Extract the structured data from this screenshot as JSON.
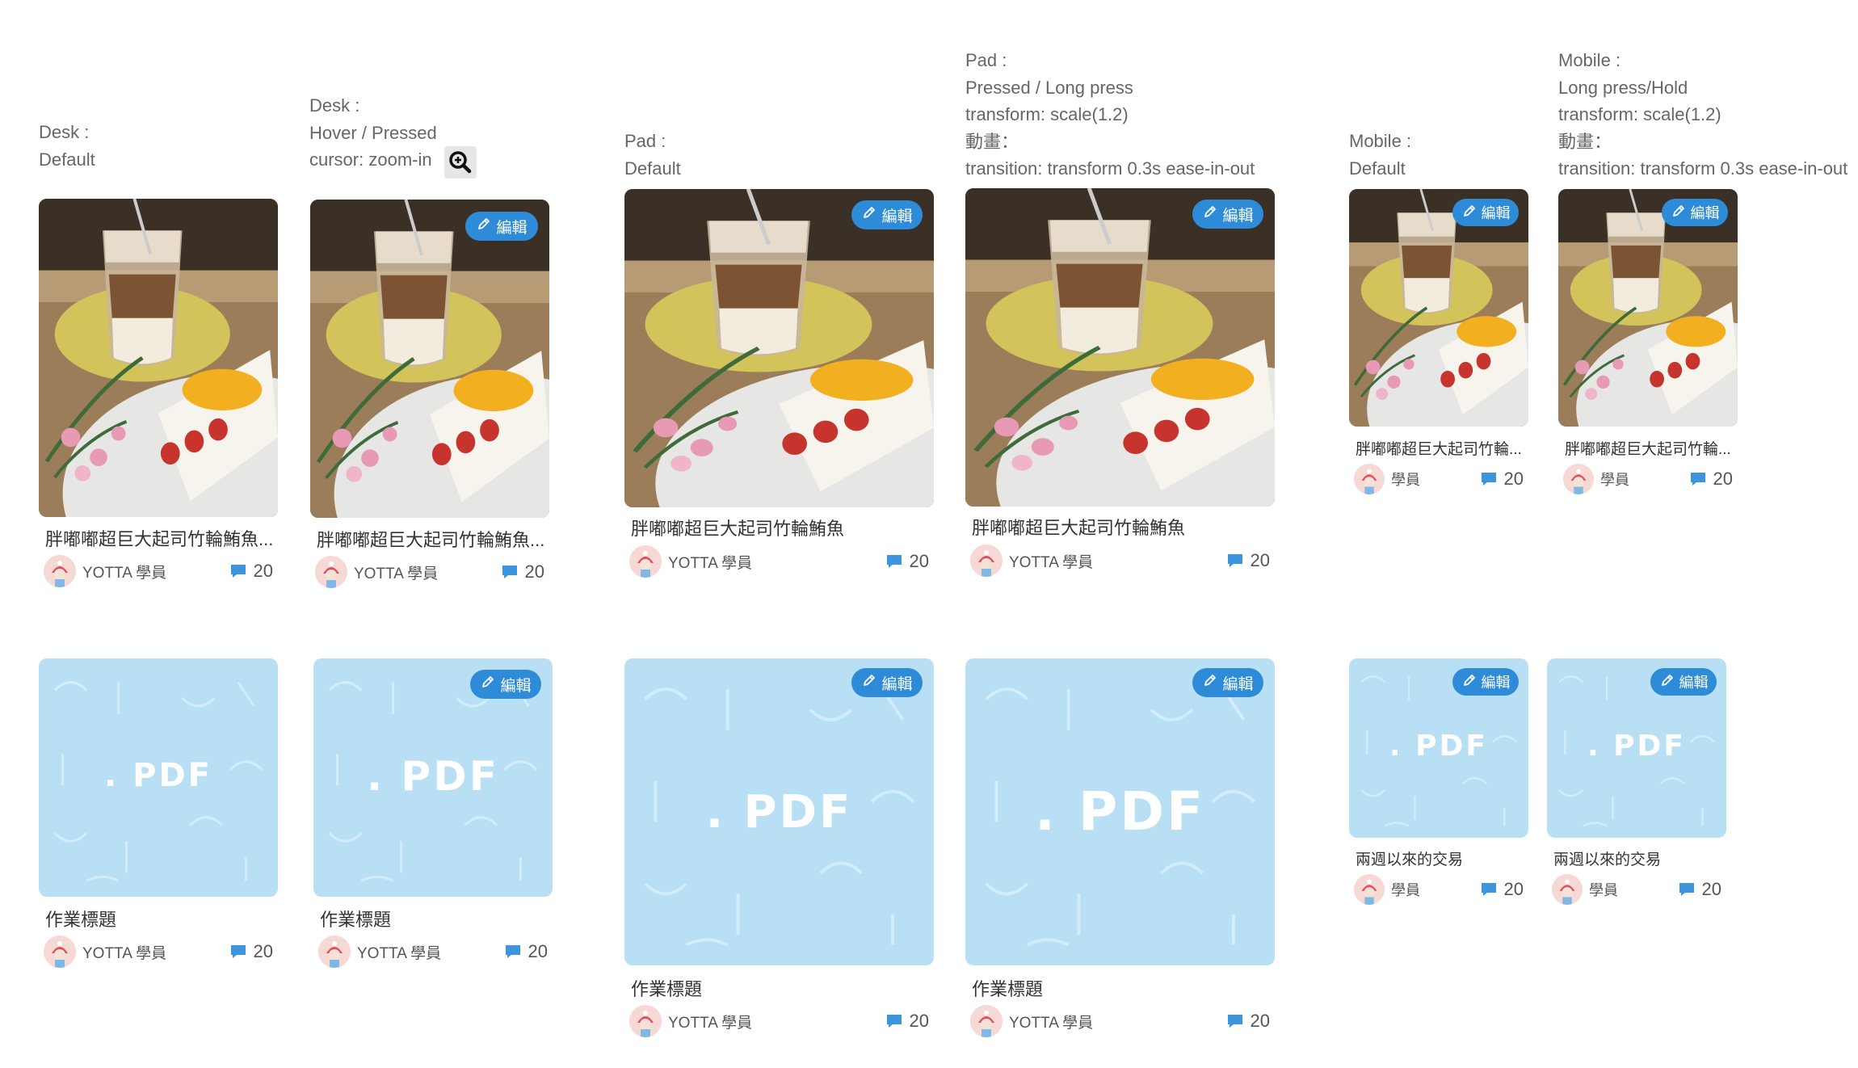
{
  "notes": {
    "desk_default": [
      "Desk :",
      "Default"
    ],
    "desk_hover": [
      "Desk :",
      "Hover / Pressed",
      "cursor: zoom-in"
    ],
    "pad_default": [
      "Pad :",
      "Default"
    ],
    "pad_pressed": [
      "Pad :",
      "Pressed / Long press",
      "transform: scale(1.2)",
      "動畫：",
      "transition: transform 0.3s ease-in-out"
    ],
    "mobile_default": [
      "Mobile :",
      "Default"
    ],
    "mobile_hold": [
      "Mobile :",
      "Long press/Hold",
      "transform: scale(1.2)",
      "動畫：",
      "transition: transform 0.3s ease-in-out"
    ]
  },
  "icons": {
    "zoom": "zoom-in-icon",
    "edit": "pencil-icon",
    "comment": "comment-bubble-icon"
  },
  "colors": {
    "accent": "#2e8bd8",
    "pdf_bg": "#b8dff4",
    "comment": "#3c95dd"
  },
  "edit_label": "編輯",
  "pdf_label": ". PDF",
  "author": "YOTTA 學員",
  "author_short": "學員",
  "comment_count": "20",
  "photo_cards": [
    {
      "title": "胖嘟嘟超巨大起司竹輪鮪魚..."
    },
    {
      "title": "胖嘟嘟超巨大起司竹輪鮪魚..."
    },
    {
      "title": "胖嘟嘟超巨大起司竹輪鮪魚"
    },
    {
      "title": "胖嘟嘟超巨大起司竹輪鮪魚"
    },
    {
      "title": "胖嘟嘟超巨大起司竹輪..."
    },
    {
      "title": "胖嘟嘟超巨大起司竹輪..."
    }
  ],
  "pdf_cards": [
    {
      "title": "作業標題"
    },
    {
      "title": "作業標題"
    },
    {
      "title": "作業標題"
    },
    {
      "title": "作業標題"
    },
    {
      "title": "兩週以來的交易"
    },
    {
      "title": "兩週以來的交易"
    }
  ]
}
